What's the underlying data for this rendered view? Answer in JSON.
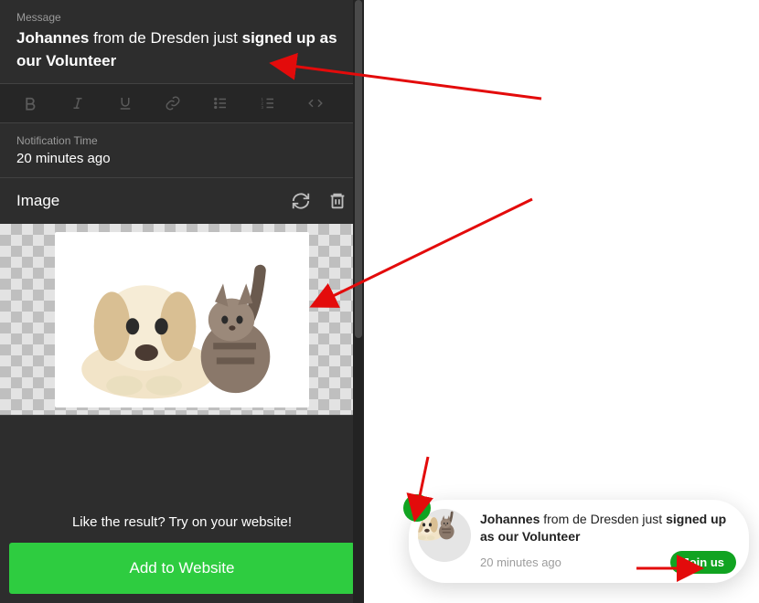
{
  "editor": {
    "message_label": "Message",
    "message_parts": {
      "bold1": "Johannes",
      "mid": " from de Dresden just ",
      "bold2": "signed up as our Volunteer"
    },
    "notif_time_label": "Notification Time",
    "notif_time_value": "20 minutes ago",
    "image_label": "Image",
    "cta_text": "Like the result? Try on your website!",
    "cta_button": "Add to Website"
  },
  "preview": {
    "message_parts": {
      "bold1": "Johannes",
      "mid": " from de Dresden just ",
      "bold2": "signed up as our Volunteer"
    },
    "time": "20 minutes ago",
    "join_label": "Join us"
  }
}
